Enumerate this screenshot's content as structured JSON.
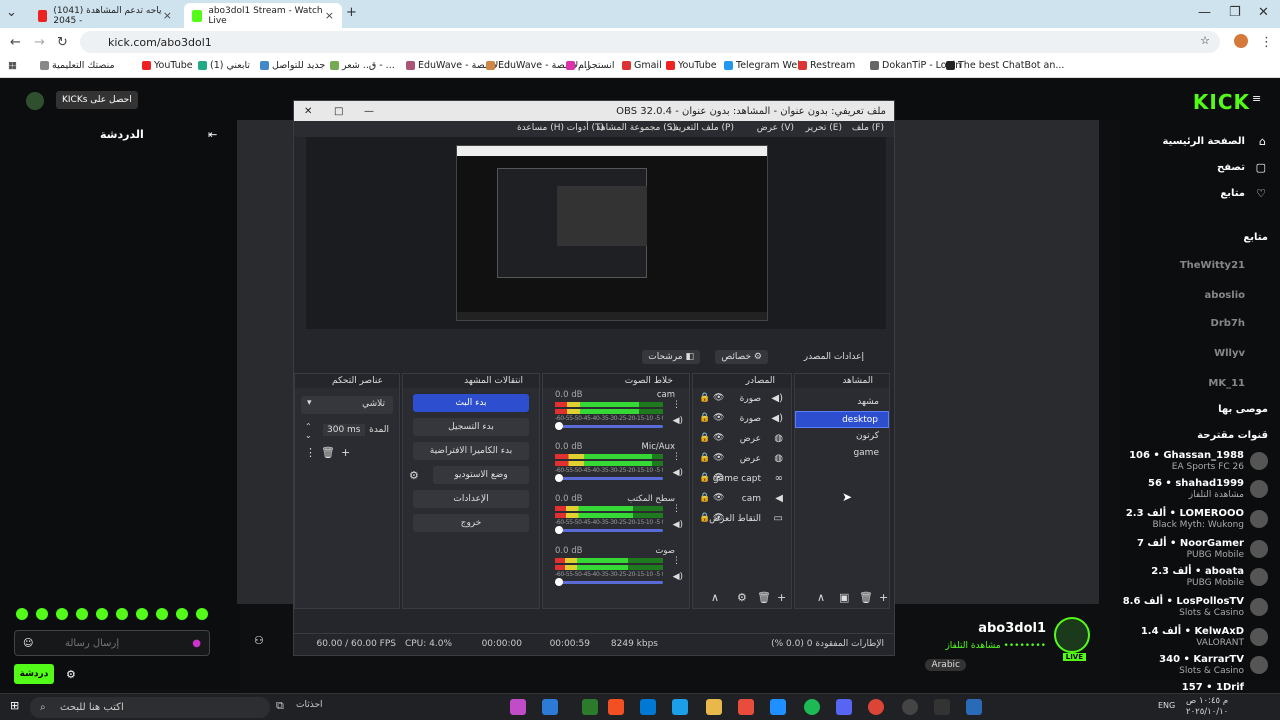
{
  "browser": {
    "tabs": [
      {
        "label": "(1041) ياحه تدعم المشاهدة - 2045",
        "active": false
      },
      {
        "label": "abo3dol1 Stream - Watch Live",
        "active": true
      }
    ],
    "address": "kick.com/abo3dol1",
    "bookmarks": [
      "The best ChatBot an...",
      "DokanTiP - Login",
      "Restream",
      "Telegram Web",
      "YouTube",
      "Gmail",
      "انستجرام",
      "EduWave - ا...لامنصة",
      "ق.. شعر - ...",
      "جديد للتواصل",
      "تابعني (1)",
      "YouTube",
      "منصتك التعليمية"
    ]
  },
  "kick": {
    "logo": "KICK",
    "nav": [
      "الصفحة الرئيسية",
      "تصفح",
      "متابع"
    ],
    "following_header": "متابع",
    "followed": [
      "TheWitty21",
      "aboslio",
      "Drb7h",
      "Wllyv",
      "MK_11"
    ],
    "recommended_header": "موصى بها",
    "live_header": "قنوات مقترحة",
    "channels": [
      {
        "name": "Ghassan_1988",
        "viewers": "106",
        "game": "EA Sports FC 26"
      },
      {
        "name": "shahad1999",
        "viewers": "56",
        "game": "مشاهدة التلفاز"
      },
      {
        "name": "LOMEROOO",
        "viewers": "2.3 ألف",
        "game": "Black Myth: Wukong"
      },
      {
        "name": "NoorGamer",
        "viewers": "7 ألف",
        "game": "PUBG Mobile"
      },
      {
        "name": "aboata",
        "viewers": "2.3 ألف",
        "game": "PUBG Mobile"
      },
      {
        "name": "LosPollosTV",
        "viewers": "8.6 ألف",
        "game": "Slots & Casino"
      },
      {
        "name": "KelwAxD",
        "viewers": "1.4 ألف",
        "game": "VALORANT"
      },
      {
        "name": "KarrarTV",
        "viewers": "340",
        "game": "Slots & Casino"
      },
      {
        "name": "1Drif",
        "viewers": "157",
        "game": ""
      }
    ],
    "chat_title": "الدردشة",
    "chat_placeholder": "إرسال رسالة",
    "chat_send": "دردشة",
    "badge": "KICKs احصل على",
    "streamer_name": "abo3dol1",
    "streamer_sub": "مشاهدة التلفاز ••••••••",
    "lang": "Arabic",
    "live": "LIVE"
  },
  "obs": {
    "title": "OBS 32.0.4 - ملف تعريفي: بدون عنوان - المشاهد: بدون عنوان",
    "menu": [
      "ملف (F)",
      "تحرير (E)",
      "عرض (V)",
      "ملف التعريف (P)",
      "مجموعة المشاهد (S)",
      "أدوات (T)",
      "مساعدة (H)"
    ],
    "toolbar": [
      "إعدادات المصدر",
      "خصائص",
      "مرشحات"
    ],
    "docks": {
      "scenes": "المشاهد",
      "sources": "المصادر",
      "mixer": "خلاط الصوت",
      "transitions": "انتقالات المشهد",
      "controls": "عناصر التحكم"
    },
    "scenes": [
      "مشهد",
      "desktop",
      "كرتون",
      "game"
    ],
    "selected_scene": "desktop",
    "sources": [
      "صورة",
      "صورة",
      "عرض",
      "عرض",
      "game capt",
      "cam",
      "التقاط العرض"
    ],
    "mixer": [
      {
        "name": "cam",
        "db": "0.0 dB",
        "level": 0.78
      },
      {
        "name": "Mic/Aux",
        "db": "0.0 dB",
        "level": 0.9
      },
      {
        "name": "سطح المكتب",
        "db": "0.0 dB",
        "level": 0.72
      },
      {
        "name": "صوت",
        "db": "0.0 dB",
        "level": 0.68
      }
    ],
    "controls": [
      "بدء البث",
      "بدء التسجيل",
      "بدء الكاميرا الافتراضية",
      "وضع الاستوديو",
      "الإعدادات",
      "خروج"
    ],
    "transition": "تلاشي",
    "duration": "300 ms",
    "duration_label": "المدة",
    "status": {
      "fps": "60.00 / 60.00 FPS",
      "cpu": "CPU: 4.0%",
      "rec": "00:00:00",
      "stream": "00:00:59",
      "kbps": "8249 kbps",
      "dropped": "الإطارات المفقودة 0 (0.0 %)"
    }
  },
  "taskbar": {
    "search": "اكتب هنا للبحث",
    "weather": "احذثات",
    "time": "م ١٠:٤٥ ص",
    "date": "٢٠٢٥/١٠/١٠",
    "lang": "ENG"
  }
}
